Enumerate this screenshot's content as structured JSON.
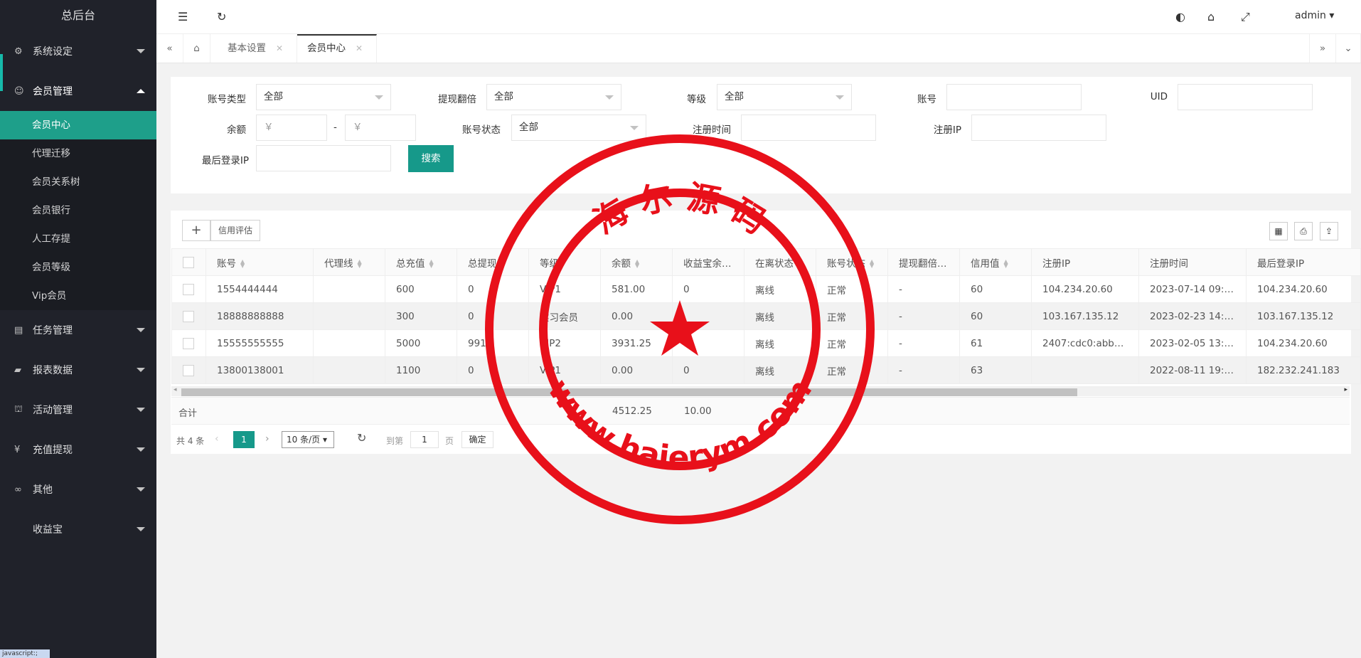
{
  "app": {
    "title": "总后台",
    "user": "admin"
  },
  "sidebar": {
    "groups": [
      {
        "label": "系统设定",
        "icon": "gear-icon"
      },
      {
        "label": "会员管理",
        "icon": "user-icon"
      },
      {
        "label": "任务管理",
        "icon": "task-icon"
      },
      {
        "label": "报表数据",
        "icon": "report-icon"
      },
      {
        "label": "活动管理",
        "icon": "activity-icon"
      },
      {
        "label": "充值提现",
        "icon": "yen-icon"
      },
      {
        "label": "其他",
        "icon": "link-icon"
      },
      {
        "label": "收益宝",
        "icon": ""
      }
    ],
    "sub_items": [
      "会员中心",
      "代理迁移",
      "会员关系树",
      "会员银行",
      "人工存提",
      "会员等级",
      "Vip会员"
    ]
  },
  "tabs": [
    {
      "label": "基本设置"
    },
    {
      "label": "会员中心"
    }
  ],
  "filters": {
    "account_type": {
      "label": "账号类型",
      "value": "全部"
    },
    "withdraw_multiple": {
      "label": "提现翻倍",
      "value": "全部"
    },
    "level": {
      "label": "等级",
      "value": "全部"
    },
    "account": {
      "label": "账号",
      "value": ""
    },
    "uid": {
      "label": "UID",
      "value": ""
    },
    "balance": {
      "label": "余额",
      "min_placeholder": "￥",
      "max_placeholder": "￥",
      "sep": "-"
    },
    "account_status": {
      "label": "账号状态",
      "value": "全部"
    },
    "register_time": {
      "label": "注册时间",
      "value": ""
    },
    "register_ip": {
      "label": "注册IP",
      "value": ""
    },
    "last_login_ip": {
      "label": "最后登录IP",
      "value": ""
    },
    "search_label": "搜索"
  },
  "toolbar": {
    "add_label": "+",
    "credit_label": "信用评估"
  },
  "table": {
    "columns": [
      "账号",
      "代理线",
      "总充值",
      "总提现",
      "等级",
      "余额",
      "收益宝余...",
      "在离状态",
      "账号状态",
      "提现翻倍...",
      "信用值",
      "注册IP",
      "注册时间",
      "最后登录IP"
    ],
    "rows": [
      [
        "1554444444",
        "",
        "600",
        "0",
        "VIP1",
        "581.00",
        "0",
        "离线",
        "正常",
        "-",
        "60",
        "104.234.20.60",
        "2023-07-14 09:5...",
        "104.234.20.60"
      ],
      [
        "18888888888",
        "",
        "300",
        "0",
        "实习会员",
        "0.00",
        "",
        "离线",
        "正常",
        "-",
        "60",
        "103.167.135.12",
        "2023-02-23 14:2...",
        "103.167.135.12"
      ],
      [
        "15555555555",
        "",
        "5000",
        "991",
        "VIP2",
        "3931.25",
        "",
        "离线",
        "正常",
        "-",
        "61",
        "2407:cdc0:abb0:...",
        "2023-02-05 13:2...",
        "104.234.20.60"
      ],
      [
        "13800138001",
        "",
        "1100",
        "0",
        "VIP1",
        "0.00",
        "0",
        "离线",
        "正常",
        "-",
        "63",
        "",
        "2022-08-11 19:3...",
        "182.232.241.183"
      ]
    ],
    "summary": {
      "label": "合计",
      "balance": "4512.25",
      "yield": "10.00"
    }
  },
  "pagination": {
    "total": "共 4 条",
    "current": "1",
    "page_size": "10 条/页",
    "goto_label": "到第",
    "goto_value": "1",
    "page_unit": "页",
    "confirm": "确定"
  },
  "watermark": {
    "top_text": "海 尔 源 码",
    "bottom_text": "www.haierym.com",
    "color": "#e8101a"
  },
  "status_bar": {
    "text": "javascript:;"
  }
}
